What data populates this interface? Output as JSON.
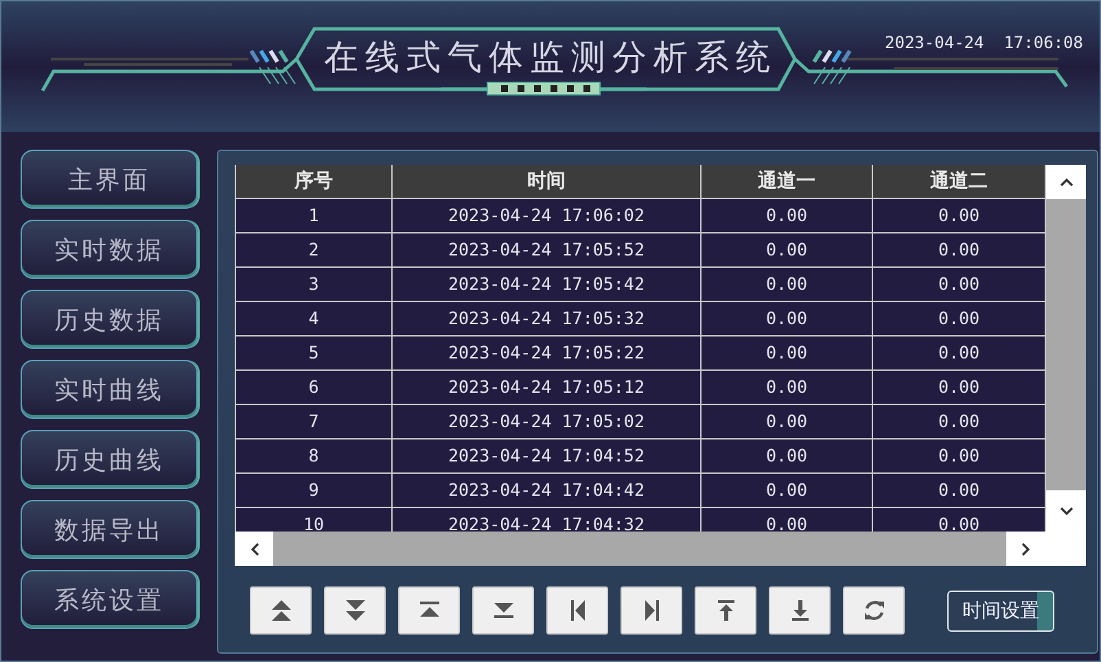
{
  "header": {
    "title": "在线式气体监测分析系统",
    "datetime": "2023-04-24  17:06:08"
  },
  "sidebar": {
    "items": [
      {
        "label": "主界面"
      },
      {
        "label": "实时数据"
      },
      {
        "label": "历史数据"
      },
      {
        "label": "实时曲线"
      },
      {
        "label": "历史曲线"
      },
      {
        "label": "数据导出"
      },
      {
        "label": "系统设置"
      }
    ]
  },
  "table": {
    "columns": [
      "序号",
      "时间",
      "通道一",
      "通道二"
    ],
    "rows": [
      [
        "1",
        "2023-04-24 17:06:02",
        "0.00",
        "0.00"
      ],
      [
        "2",
        "2023-04-24 17:05:52",
        "0.00",
        "0.00"
      ],
      [
        "3",
        "2023-04-24 17:05:42",
        "0.00",
        "0.00"
      ],
      [
        "4",
        "2023-04-24 17:05:32",
        "0.00",
        "0.00"
      ],
      [
        "5",
        "2023-04-24 17:05:22",
        "0.00",
        "0.00"
      ],
      [
        "6",
        "2023-04-24 17:05:12",
        "0.00",
        "0.00"
      ],
      [
        "7",
        "2023-04-24 17:05:02",
        "0.00",
        "0.00"
      ],
      [
        "8",
        "2023-04-24 17:04:52",
        "0.00",
        "0.00"
      ],
      [
        "9",
        "2023-04-24 17:04:42",
        "0.00",
        "0.00"
      ],
      [
        "10",
        "2023-04-24 17:04:32",
        "0.00",
        "0.00"
      ]
    ]
  },
  "toolbar": {
    "buttons": [
      {
        "kind": "double_up"
      },
      {
        "kind": "double_down"
      },
      {
        "kind": "up"
      },
      {
        "kind": "down"
      },
      {
        "kind": "first"
      },
      {
        "kind": "last"
      },
      {
        "kind": "top"
      },
      {
        "kind": "bottom"
      },
      {
        "kind": "refresh"
      }
    ],
    "time_button": "时间设置"
  }
}
